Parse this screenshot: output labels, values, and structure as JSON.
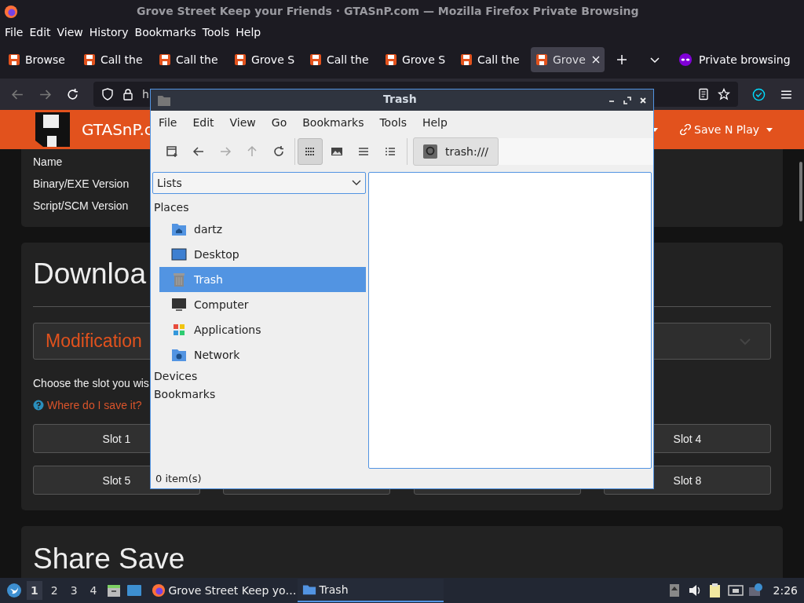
{
  "browser": {
    "title": "Grove Street Keep your Friends · GTASnP.com — Mozilla Firefox Private Browsing",
    "menu": [
      "File",
      "Edit",
      "View",
      "History",
      "Bookmarks",
      "Tools",
      "Help"
    ],
    "tabs": [
      {
        "label": "Browse",
        "selected": false
      },
      {
        "label": "Call the",
        "selected": false
      },
      {
        "label": "Call the",
        "selected": false
      },
      {
        "label": "Grove S",
        "selected": false
      },
      {
        "label": "Call the",
        "selected": false
      },
      {
        "label": "Grove S",
        "selected": false
      },
      {
        "label": "Call the",
        "selected": false
      },
      {
        "label": "Grove",
        "selected": true
      }
    ],
    "private_label": "Private browsing",
    "url": "h"
  },
  "page": {
    "site_name": "GTASnP.c",
    "nav_item": "Save N Play",
    "info_rows": [
      "Name",
      "Binary/EXE Version",
      "Script/SCM Version"
    ],
    "download_heading": "Downloa",
    "panel_title": "Modification",
    "instructions": "Choose the slot you wis",
    "help_link": "Where do I save it?",
    "slot_rows": [
      [
        "Slot 1",
        "Slot 4"
      ],
      [
        "Slot 5",
        "Slot 8"
      ]
    ],
    "share_heading": "Share Save"
  },
  "file_manager": {
    "title": "Trash",
    "menu": [
      "File",
      "Edit",
      "View",
      "Go",
      "Bookmarks",
      "Tools",
      "Help"
    ],
    "toolbar": [
      {
        "kind": "new-tab",
        "disabled": false
      },
      {
        "kind": "back",
        "disabled": false
      },
      {
        "kind": "forward",
        "disabled": true
      },
      {
        "kind": "up",
        "disabled": true
      },
      {
        "kind": "reload",
        "disabled": false
      }
    ],
    "view_modes": [
      {
        "kind": "icons",
        "selected": true
      },
      {
        "kind": "thumbnails",
        "selected": false
      },
      {
        "kind": "compact",
        "selected": false
      },
      {
        "kind": "details",
        "selected": false
      }
    ],
    "location": "trash:///",
    "side_pane": "Lists",
    "sections": [
      {
        "heading": "Places",
        "items": [
          {
            "label": "dartz",
            "kind": "home",
            "selected": false
          },
          {
            "label": "Desktop",
            "kind": "desktop",
            "selected": false
          },
          {
            "label": "Trash",
            "kind": "trash",
            "selected": true
          },
          {
            "label": "Computer",
            "kind": "computer",
            "selected": false
          },
          {
            "label": "Applications",
            "kind": "apps",
            "selected": false
          },
          {
            "label": "Network",
            "kind": "network",
            "selected": false
          }
        ]
      },
      {
        "heading": "Devices"
      },
      {
        "heading": "Bookmarks"
      }
    ],
    "status": "0 item(s)"
  },
  "taskbar": {
    "workspaces": [
      {
        "label": "1",
        "selected": true
      },
      {
        "label": "2",
        "selected": false
      },
      {
        "label": "3",
        "selected": false
      },
      {
        "label": "4",
        "selected": false
      }
    ],
    "tasks": [
      {
        "label": "Grove Street Keep yo…",
        "kind": "browser",
        "selected": false
      },
      {
        "label": "Trash",
        "kind": "folder",
        "selected": true
      }
    ],
    "clock": "2:26"
  }
}
